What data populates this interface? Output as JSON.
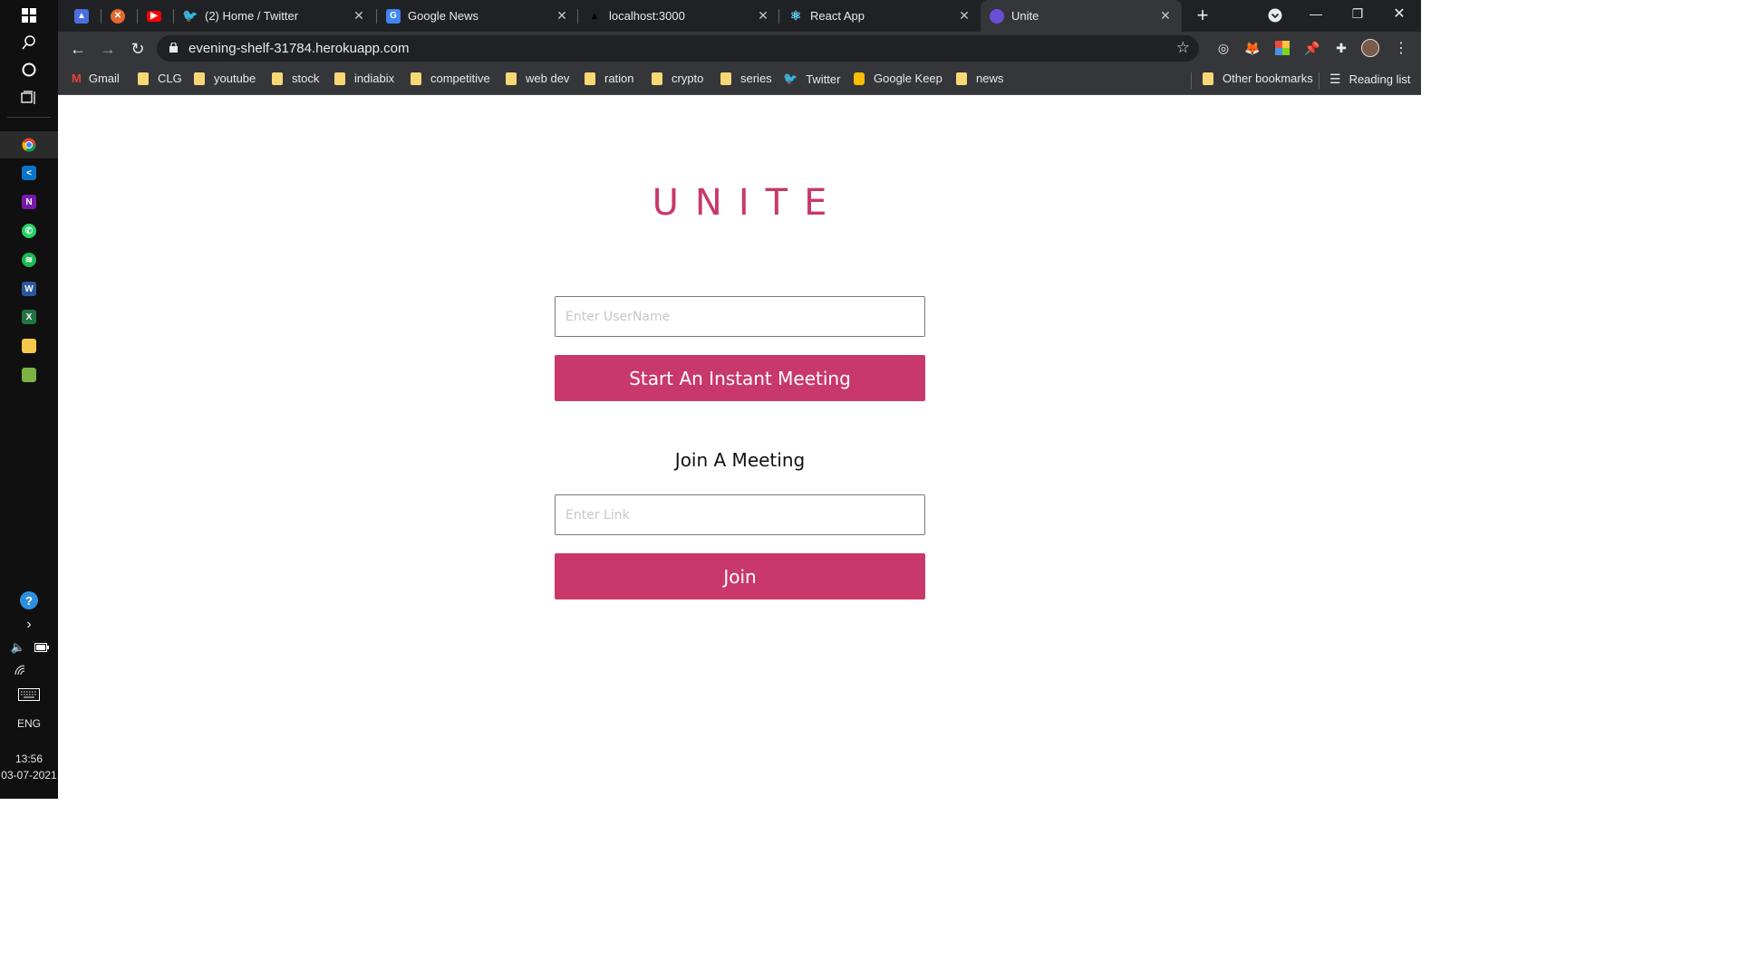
{
  "taskbar": {
    "apps": [
      "chrome",
      "vscode",
      "onenote",
      "whatsapp",
      "spotify",
      "word",
      "excel",
      "file-explorer",
      "photos"
    ],
    "language": "ENG",
    "time": "13:56",
    "date": "03-07-2021"
  },
  "browser": {
    "tabs": [
      {
        "title": "",
        "icon": "drive-icon",
        "color": "#4a6ee0"
      },
      {
        "title": "",
        "icon": "app-icon",
        "color": "#e06a2c"
      },
      {
        "title": "",
        "icon": "youtube-icon",
        "color": "#ff0000"
      },
      {
        "title": "(2) Home / Twitter",
        "icon": "twitter-icon",
        "color": "#1d9bf0"
      },
      {
        "title": "Google News",
        "icon": "google-news-icon",
        "color": "#4285f4"
      },
      {
        "title": "localhost:3000",
        "icon": "triangle-icon",
        "color": "#202124"
      },
      {
        "title": "React App",
        "icon": "react-icon",
        "color": "#61dafb"
      },
      {
        "title": "Unite",
        "icon": "unite-icon",
        "color": "#6a4fd6"
      }
    ],
    "url": "evening-shelf-31784.herokuapp.com",
    "bookmarks": [
      "Gmail",
      "CLG",
      "youtube",
      "stock",
      "indiabix",
      "competitive",
      "web dev",
      "ration",
      "crypto",
      "series",
      "Twitter",
      "Google Keep",
      "news"
    ],
    "other_bookmarks": "Other bookmarks",
    "reading_list": "Reading list"
  },
  "page": {
    "brand": "UNITE",
    "username_placeholder": "Enter UserName",
    "start_button": "Start An Instant Meeting",
    "join_heading": "Join A Meeting",
    "link_placeholder": "Enter Link",
    "join_button": "Join",
    "accent_color": "#c9386b"
  }
}
